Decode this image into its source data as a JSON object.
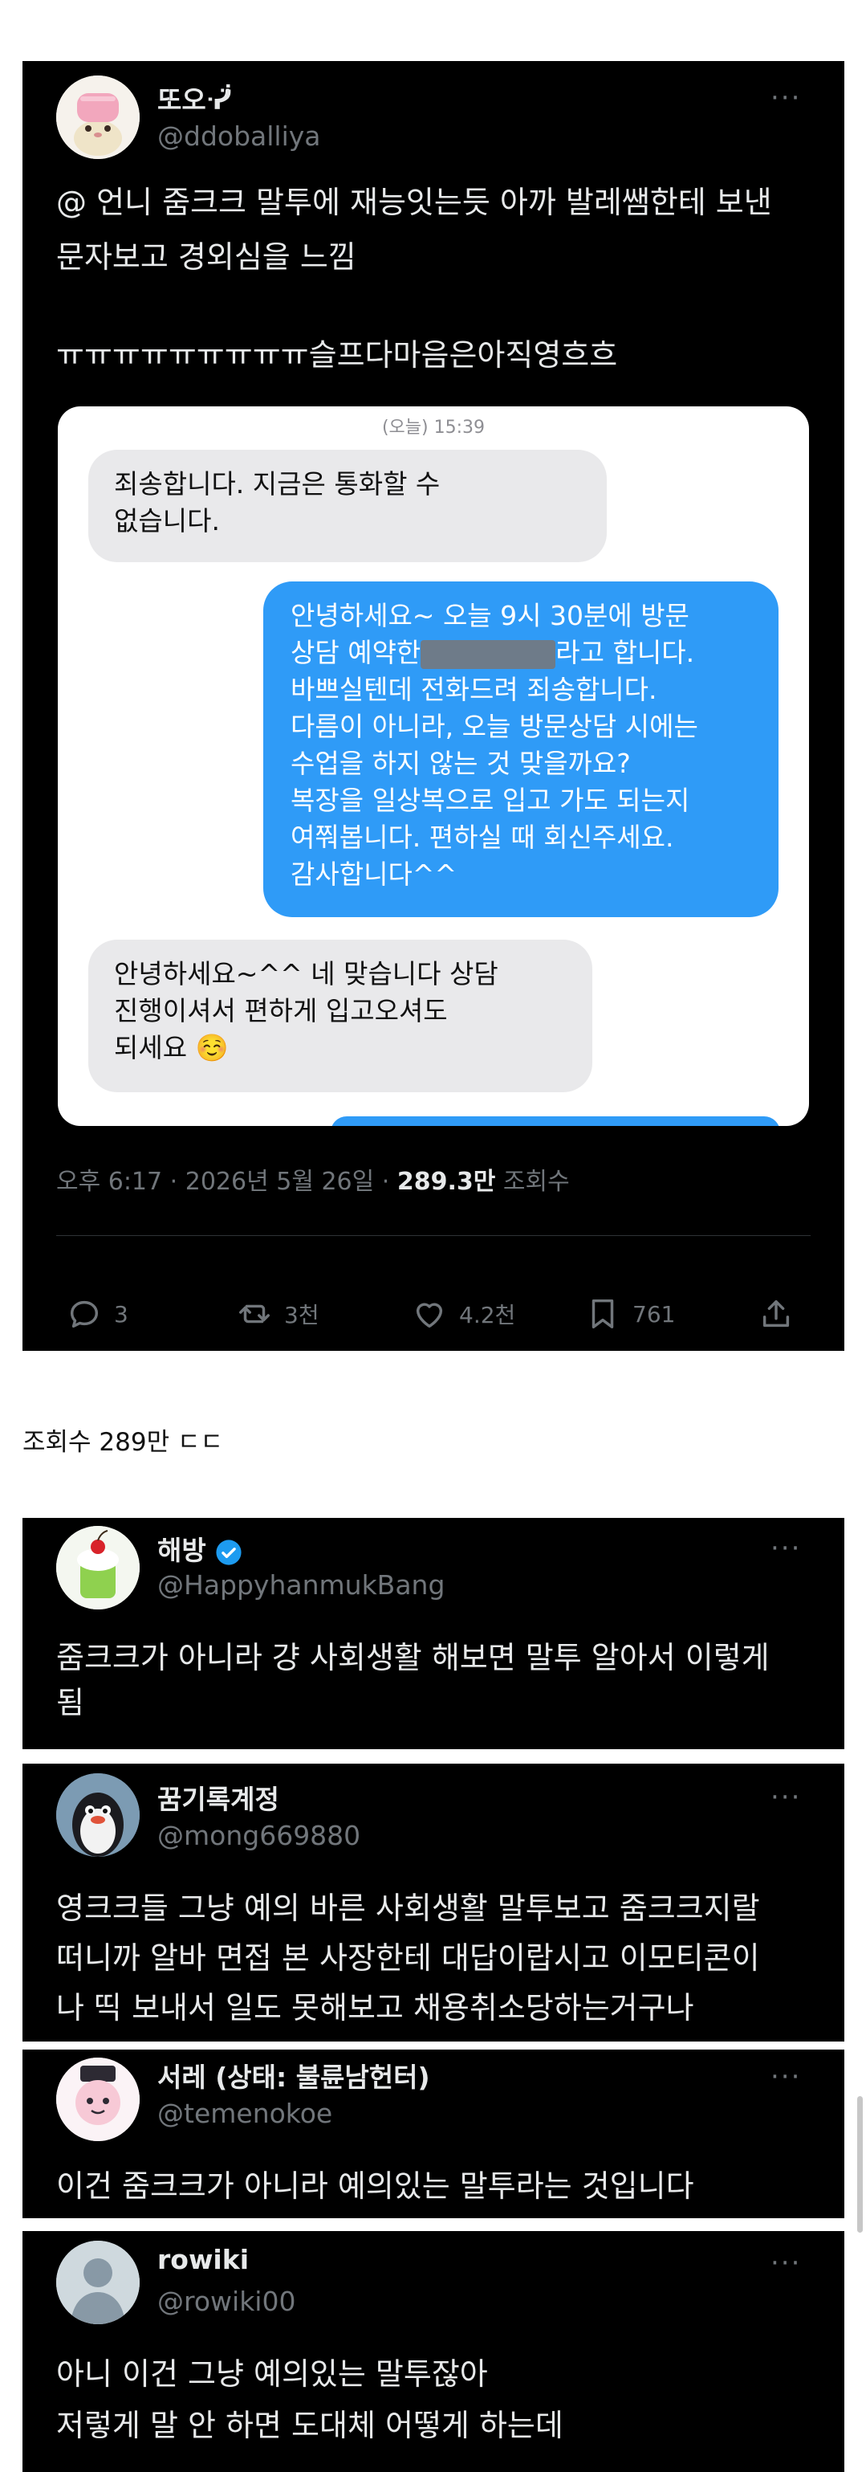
{
  "main_tweet": {
    "display_name": "또오ᓺ̈",
    "handle": "@ddoballiya",
    "more": "···",
    "text_lines": [
      "@ 언니 줌크크 말투에 재능잇는듯 아까 발레쌤한테 보낸",
      "문자보고 경외심을 느낌",
      "ㅠㅠㅠㅠㅠㅠㅠㅠㅠ슬프다마음은아직영흐흐"
    ],
    "screenshot": {
      "timestamp": "(오늘) 15:39",
      "messages": [
        {
          "side": "in",
          "lines": [
            "죄송합니다. 지금은 통화할 수",
            "없습니다."
          ]
        },
        {
          "side": "out",
          "lines": [
            "안녕하세요~ 오늘 9시 30분에 방문",
            "상담 예약한",
            "라고 합니다.",
            "바쁘실텐데 전화드려 죄송합니다.",
            "다름이 아니라, 오늘 방문상담 시에는",
            "수업을 하지 않는 것 맞을까요?",
            "복장을 일상복으로 입고 가도 되는지",
            "여쭤봅니다. 편하실 때 회신주세요.",
            "감사합니다^^"
          ]
        },
        {
          "side": "in",
          "lines": [
            "안녕하세요~^^ 네 맞습니다 상담",
            "진행이셔서 편하게 입고오셔도",
            "되세요"
          ],
          "emoji": "☺️"
        }
      ]
    },
    "meta": {
      "time": "오후 6:17",
      "date": "2026년 5월 26일",
      "sep": "·",
      "views": "289.3만",
      "views_label": "조회수"
    },
    "actions": {
      "replies": "3",
      "retweets": "3천",
      "likes": "4.2천",
      "bookmarks": "761"
    }
  },
  "caption": "조회수 289만 ㄷㄷ",
  "replies": [
    {
      "display_name": "해방",
      "handle": "@HappyhanmukBang",
      "verified": true,
      "text_lines": [
        "줌크크가 아니라 걍 사회생활 해보면 말투 알아서 이렇게",
        "됨"
      ]
    },
    {
      "display_name": "꿈기록계정",
      "handle": "@mong669880",
      "verified": false,
      "text_lines": [
        "영크크들 그냥 예의 바른 사회생활 말투보고 줌크크지랄",
        "떠니까 알바 면접 본 사장한테 대답이랍시고 이모티콘이",
        "나 띡 보내서 일도 못해보고 채용취소당하는거구나"
      ]
    },
    {
      "display_name": "서레 (상태: 불륜남헌터)",
      "handle": "@temenokoe",
      "verified": false,
      "text_lines": [
        "이건 줌크크가 아니라 예의있는 말투라는 것입니다"
      ]
    },
    {
      "display_name": "rowiki",
      "handle": "@rowiki00",
      "verified": false,
      "text_lines": [
        "아니 이건 그냥 예의있는 말투잖아",
        "저렇게 말 안 하면 도대체 어떻게 하는데"
      ]
    }
  ],
  "colors": {
    "card_bg": "#000000",
    "text": "#e7e9ea",
    "muted": "#71767b",
    "imessage_blue": "#2f9bf7",
    "imessage_gray": "#e9e9eb",
    "verified_blue": "#1d9bf0"
  }
}
